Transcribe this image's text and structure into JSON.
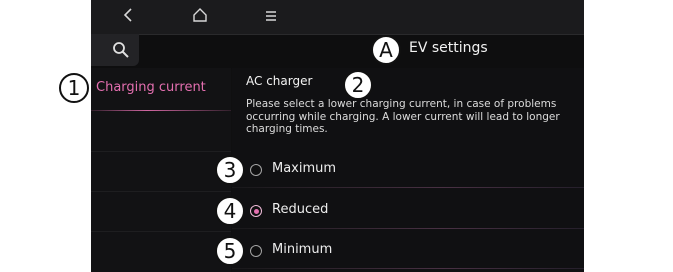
{
  "nav": {
    "back_icon": "back-icon",
    "home_icon": "home-icon",
    "menu_icon": "menu-icon"
  },
  "header": {
    "title": "EV settings",
    "search_icon": "search-icon"
  },
  "sidebar": {
    "items": [
      {
        "label": "Charging current",
        "selected": true
      }
    ]
  },
  "content": {
    "section_title": "AC charger",
    "description": "Please select a lower charging current, in case of problems occurring while charging. A lower current will lead to longer charging times.",
    "options": [
      {
        "label": "Maximum",
        "selected": false
      },
      {
        "label": "Reduced",
        "selected": true
      },
      {
        "label": "Minimum",
        "selected": false
      }
    ]
  },
  "callouts": [
    "A",
    "1",
    "2",
    "3",
    "4",
    "5"
  ],
  "colors": {
    "accent": "#e46fb0",
    "background": "#0f0f10"
  }
}
